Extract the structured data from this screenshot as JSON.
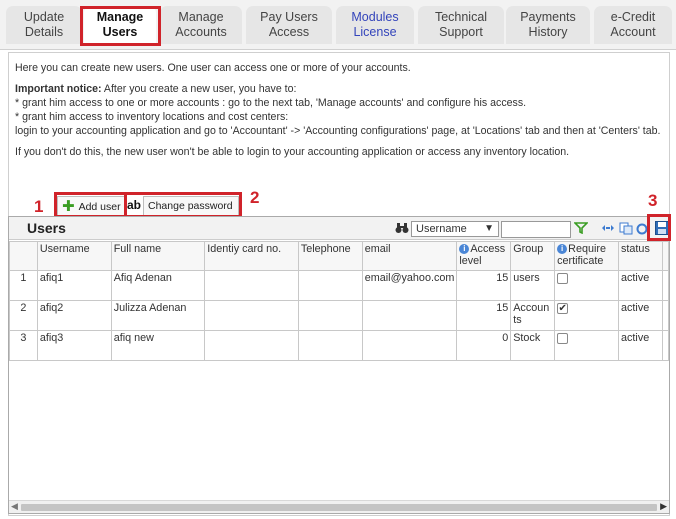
{
  "tabs": [
    {
      "line1": "Update",
      "line2": "Details"
    },
    {
      "line1": "Manage",
      "line2": "Users"
    },
    {
      "line1": "Manage",
      "line2": "Accounts"
    },
    {
      "line1": "Pay Users",
      "line2": "Access"
    },
    {
      "line1": "Modules",
      "line2": "License"
    },
    {
      "line1": "Technical",
      "line2": "Support"
    },
    {
      "line1": "Payments",
      "line2": "History"
    },
    {
      "line1": "e-Credit",
      "line2": "Account"
    }
  ],
  "intro": {
    "line1": "Here you can create new users. One user can access one or more of your accounts.",
    "notice_label": "Important notice:",
    "notice_text": " After you create a new user, you have to:",
    "bullet1": "* grant him access to one or more accounts : go to the next tab, 'Manage accounts' and configure his access.",
    "bullet2": "* grant him access to inventory locations and cost centers:",
    "line5": "login to your accounting application and go to 'Accountant' -> 'Accounting configurations' page, at 'Locations' tab and then at 'Centers' tab.",
    "line6": "If you don't do this, the new user won't be able to login to your accounting application or access any inventory location."
  },
  "annotations": {
    "n1": "1",
    "n2": "2",
    "n3": "3"
  },
  "toolbar": {
    "add_user": "Add user",
    "change_password": "Change password",
    "cursor_text": "ab"
  },
  "grid": {
    "title": "Users",
    "search_column": "Username",
    "search_value": "",
    "columns": [
      "",
      "Username",
      "Full name",
      "Identiy card no.",
      "Telephone",
      "email",
      "Access level",
      "Group",
      "Require certificate",
      "status"
    ],
    "rows": [
      {
        "num": "1",
        "username": "afiq1",
        "full_name": "Afiq Adenan",
        "id_card": "",
        "telephone": "",
        "email": "email@yahoo.com",
        "access_level": "15",
        "group": "users",
        "require_certificate": false,
        "status": "active"
      },
      {
        "num": "2",
        "username": "afiq2",
        "full_name": "Julizza Adenan",
        "id_card": "",
        "telephone": "",
        "email": "",
        "access_level": "15",
        "group": "Accounts",
        "require_certificate": true,
        "status": "active"
      },
      {
        "num": "3",
        "username": "afiq3",
        "full_name": "afiq new",
        "id_card": "",
        "telephone": "",
        "email": "",
        "access_level": "0",
        "group": "Stock",
        "require_certificate": false,
        "status": "active"
      }
    ]
  },
  "colors": {
    "highlight": "#d0232a",
    "link": "#3344bb",
    "add_icon": "#3a9d23"
  },
  "icons": [
    "binoculars-icon",
    "filter-icon",
    "columns-icon",
    "copy-icon",
    "refresh-icon",
    "save-icon",
    "plus-icon",
    "info-icon"
  ]
}
